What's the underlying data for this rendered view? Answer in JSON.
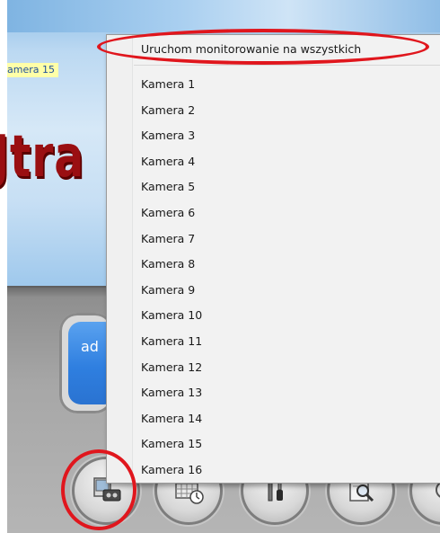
{
  "background": {
    "camera_tag": "amera 15",
    "title_text": "Jtra",
    "user_button_text": "ad"
  },
  "menu": {
    "header_item": "Uruchom monitorowanie na wszystkich",
    "items": [
      "Kamera 1",
      "Kamera 2",
      "Kamera 3",
      "Kamera 4",
      "Kamera 5",
      "Kamera 6",
      "Kamera 7",
      "Kamera 8",
      "Kamera 9",
      "Kamera 10",
      "Kamera 11",
      "Kamera 12",
      "Kamera 13",
      "Kamera 14",
      "Kamera 15",
      "Kamera 16"
    ]
  },
  "toolbar": {
    "buttons": [
      "camera-monitor-icon",
      "schedule-icon",
      "tools-icon",
      "search-document-icon",
      "extra-icon"
    ]
  },
  "colors": {
    "annotation": "#e0161d",
    "title": "#9a0f12",
    "user_button": "#2f7fe0",
    "camera_tag_bg": "#ffffa8"
  }
}
